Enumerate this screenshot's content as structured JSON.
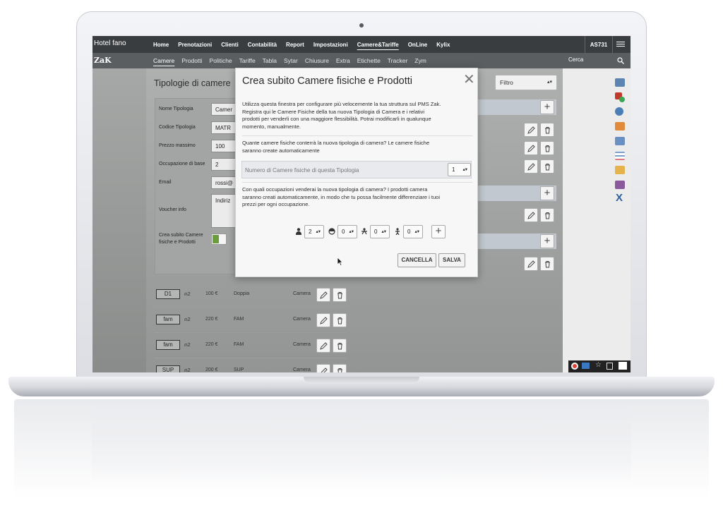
{
  "app": {
    "hotel_name": "Hotel fano",
    "brand": "ZaK",
    "user_code": "AS731",
    "search_label": "Cerca"
  },
  "main_nav": [
    "Home",
    "Prenotazioni",
    "Clienti",
    "Contabilità",
    "Report",
    "Impostazioni",
    "Camere&Tariffe",
    "OnLine",
    "Kylix"
  ],
  "main_nav_active": "Camere&Tariffe",
  "sub_nav": [
    "Camere",
    "Prodotti",
    "Politiche",
    "Tariffe",
    "Tabla",
    "Sytar",
    "Chiusure",
    "Extra",
    "Etichette",
    "Tracker",
    "Zym"
  ],
  "sub_nav_active": "Camere",
  "page": {
    "title": "Tipologie di camere",
    "filter_label": "Filtro"
  },
  "form": {
    "nome_label": "Nome Tipologia",
    "nome_value": "Camer",
    "codice_label": "Codice Tipologia",
    "codice_value": "MATR",
    "prezzo_label": "Prezzo massimo",
    "prezzo_value": "100",
    "occupazione_label": "Occupazione di base",
    "occupazione_value": "2",
    "email_label": "Email",
    "email_value": "rossi@",
    "voucher_label": "Voucher info",
    "voucher_value": "Indiriz",
    "crea_label_1": "Crea subito Camere",
    "crea_label_2": "fisiche e Prodotti"
  },
  "rooms": [
    {
      "code": "D1",
      "occ": "2",
      "price": "100 €",
      "name": "Doppia",
      "type": "Camera"
    },
    {
      "code": "fam",
      "occ": "2",
      "price": "220 €",
      "name": "FAM",
      "type": "Camera"
    },
    {
      "code": "fam",
      "occ": "2",
      "price": "220 €",
      "name": "FAM",
      "type": "Camera"
    },
    {
      "code": "SUP",
      "occ": "2",
      "price": "200 €",
      "name": "SUP",
      "type": "Camera"
    }
  ],
  "modal": {
    "title": "Crea subito Camere fisiche e Prodotti",
    "close": "✕",
    "intro_1": "Utilizza questa finestra per configurare più velocemente la tua struttura sul PMS Zak.",
    "intro_2": "Registra qui le Camere Fisiche della tua nuova Tipologia di Camera e i relativi",
    "intro_3": "prodotti per venderli con una maggiore flessibilità. Potrai modificarli in qualunque",
    "intro_4": "momento, manualmente.",
    "q1_1": "Quante camere fisiche conterrà la nuova tipologia di camera? Le camere fisiche",
    "q1_2": "saranno create automaticamente",
    "rooms_placeholder": "Numero di Camere fisiche di questa Tipologia",
    "rooms_count": "1",
    "q2_1": "Con quali occupazioni venderai la nuova tipologia di camera? I prodotti camera",
    "q2_2": "saranno creati automaticamente, in modo che tu possa facilmente differenziare i tuoi",
    "q2_3": "prezzi per ogni occupazione.",
    "occ_adults": "2",
    "occ_children": "0",
    "occ_teens": "0",
    "occ_infants": "0",
    "cancel_label": "CANCELLA",
    "save_label": "SALVA"
  },
  "colors": {
    "topbar": "#3a3d40",
    "subbar": "#5b5e60",
    "toggle_on": "#6a9e3a",
    "group_bar": "#c1c8cf"
  }
}
